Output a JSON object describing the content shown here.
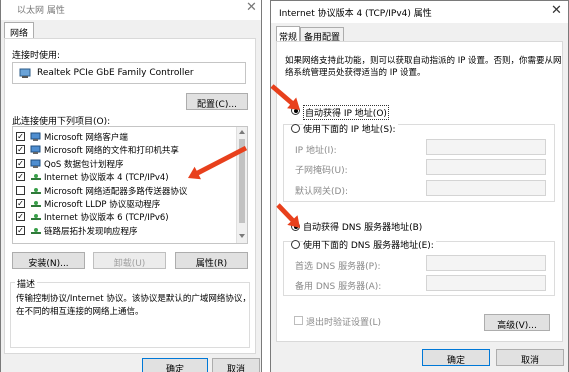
{
  "left_window": {
    "title": "以太网 属性",
    "close_glyph": "✕",
    "tab": "网络",
    "connect_label": "连接时使用:",
    "adapter": "Realtek PCIe GbE Family Controller",
    "configure_button": "配置(C)...",
    "items_label": "此连接使用下列项目(O):",
    "items": [
      {
        "text": "Microsoft 网络客户端",
        "checked": true,
        "icon": "network-client-icon"
      },
      {
        "text": "Microsoft 网络的文件和打印机共享",
        "checked": true,
        "icon": "network-client-icon"
      },
      {
        "text": "QoS 数据包计划程序",
        "checked": true,
        "icon": "network-client-icon"
      },
      {
        "text": "Internet 协议版本 4 (TCP/IPv4)",
        "checked": true,
        "icon": "protocol-icon"
      },
      {
        "text": "Microsoft 网络适配器多路传送器协议",
        "checked": false,
        "icon": "protocol-icon"
      },
      {
        "text": "Microsoft LLDP 协议驱动程序",
        "checked": true,
        "icon": "protocol-icon"
      },
      {
        "text": "Internet 协议版本 6 (TCP/IPv6)",
        "checked": true,
        "icon": "protocol-icon"
      },
      {
        "text": "链路层拓扑发现响应程序",
        "checked": true,
        "icon": "protocol-icon"
      }
    ],
    "install_button": "安装(N)...",
    "uninstall_button": "卸载(U)",
    "properties_button": "属性(R)",
    "description_label": "描述",
    "description_text_line1": "传输控制协议/Internet 协议。该协议是默认的广域网络协议，",
    "description_text_line2": "在不同的相互连接的网络上通信。",
    "ok_button": "确定",
    "cancel_button": "取消"
  },
  "right_window": {
    "title": "Internet 协议版本 4 (TCP/IPv4) 属性",
    "close_glyph": "✕",
    "tabs": [
      "常规",
      "备用配置"
    ],
    "intro_line1": "如果网络支持此功能，则可以获取自动指派的 IP 设置。否则，你需要从网",
    "intro_line2": "络系统管理员处获得适当的 IP 设置。",
    "auto_ip_radio": "自动获得 IP 地址(O)",
    "manual_ip_radio": "使用下面的 IP 地址(S):",
    "ip_address_label": "IP 地址(I):",
    "subnet_label": "子网掩码(U):",
    "gateway_label": "默认网关(D):",
    "auto_dns_radio": "自动获得 DNS 服务器地址(B)",
    "manual_dns_radio": "使用下面的 DNS 服务器地址(E):",
    "preferred_dns_label": "首选 DNS 服务器(P):",
    "alternate_dns_label": "备用 DNS 服务器(A):",
    "validate_checkbox": "退出时验证设置(L)",
    "advanced_button": "高级(V)...",
    "ok_button": "确定",
    "cancel_button": "取消"
  },
  "colors": {
    "annotation_arrow": "#e8401c",
    "window_bg": "#f0f0f0",
    "primary_border": "#0078d7"
  }
}
